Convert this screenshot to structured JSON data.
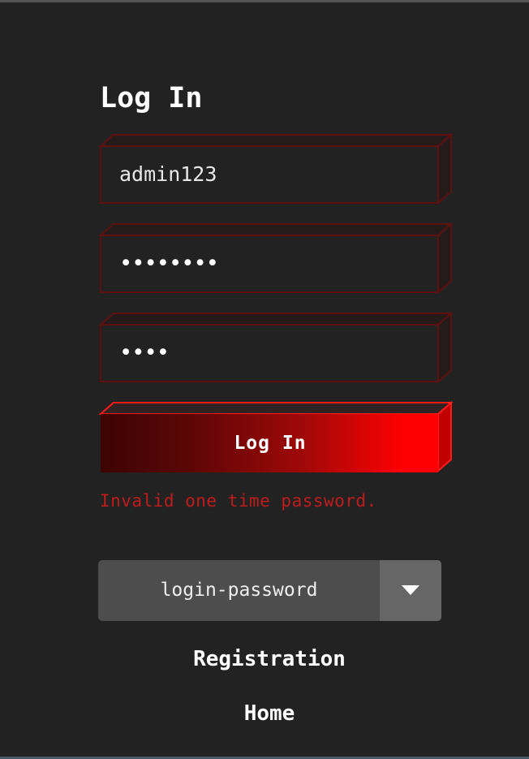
{
  "form": {
    "title": "Log In",
    "username_value": "admin123",
    "password_value": "********",
    "otp_value": "****",
    "submit_label": "Log In",
    "error_message": "Invalid one time password."
  },
  "method_select": {
    "selected": "login-password"
  },
  "links": {
    "registration": "Registration",
    "home": "Home"
  },
  "colors": {
    "background": "#222222",
    "accent_red": "#ff0000",
    "dark_red": "#5a0a0a",
    "error_text": "#c01c1c",
    "field_outline": "#5e1010"
  },
  "icons": {
    "dropdown": "chevron-down-icon"
  }
}
